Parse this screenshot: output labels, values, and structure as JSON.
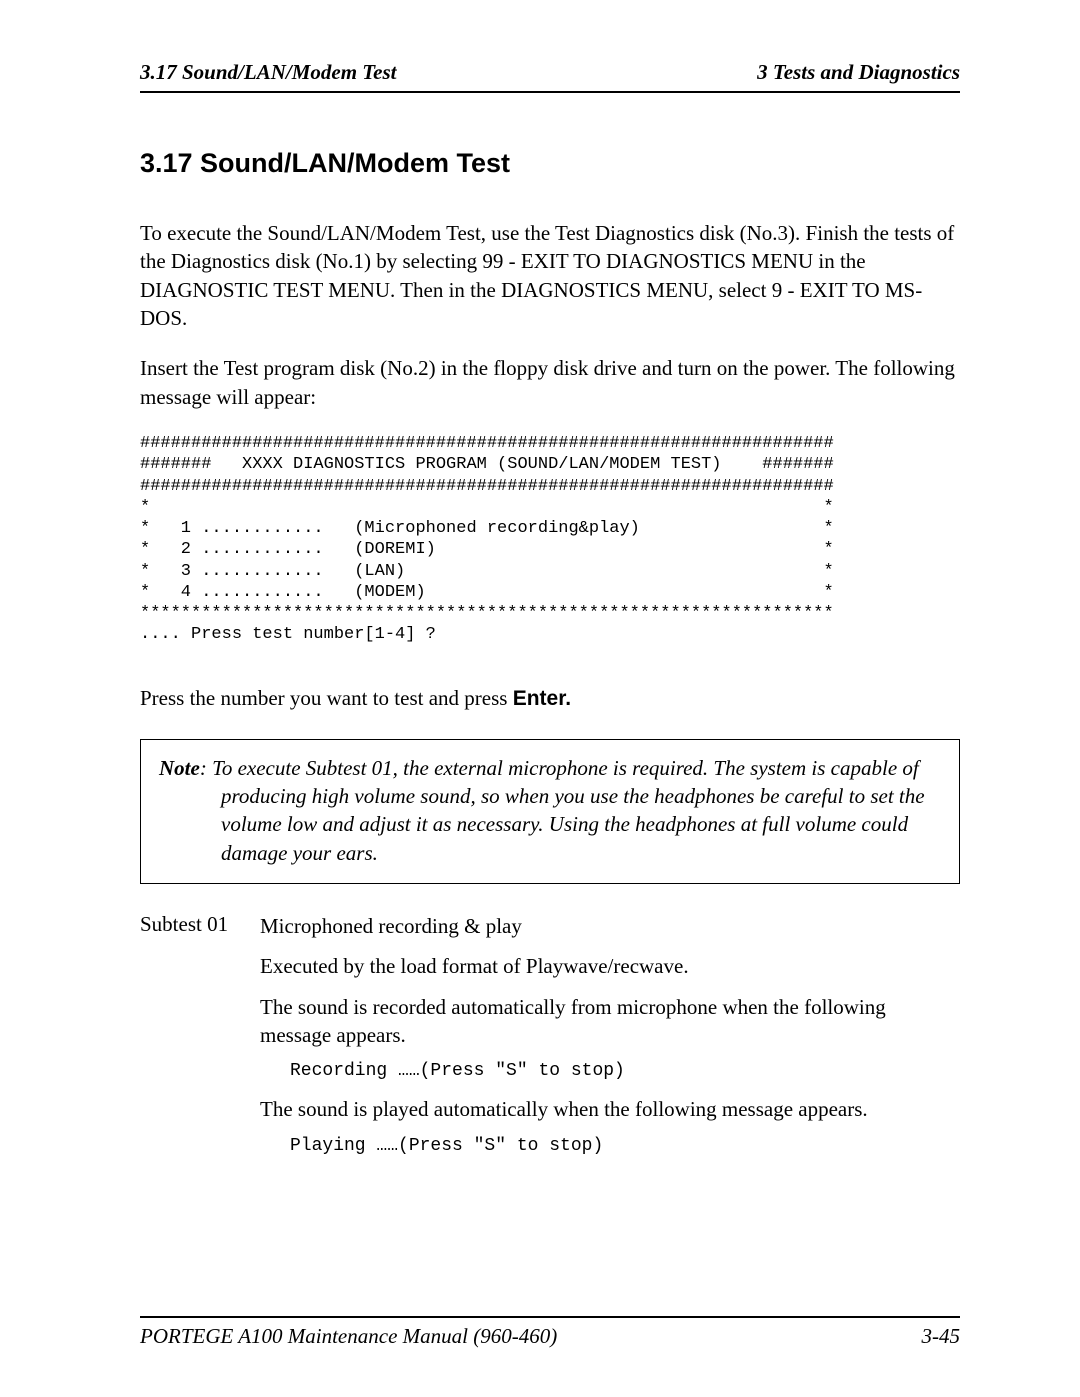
{
  "header": {
    "left": "3.17  Sound/LAN/Modem Test",
    "right": "3 Tests and Diagnostics"
  },
  "heading": "3.17  Sound/LAN/Modem Test",
  "para1": "To execute the Sound/LAN/Modem Test, use the Test Diagnostics disk (No.3). Finish the tests of the Diagnostics disk (No.1) by selecting 99 - EXIT TO DIAGNOSTICS MENU in the DIAGNOSTIC TEST MENU. Then in the DIAGNOSTICS MENU, select 9 - EXIT TO MS-DOS.",
  "para2": "Insert the Test program disk (No.2) in the floppy disk drive and turn on the power. The following message will appear:",
  "code": "####################################################################\n#######   XXXX DIAGNOSTICS PROGRAM (SOUND/LAN/MODEM TEST)    #######\n####################################################################\n*                                                                  *\n*   1 ............   (Microphoned recording&play)                  *\n*   2 ............   (DOREMI)                                      *\n*   3 ............   (LAN)                                         *\n*   4 ............   (MODEM)                                       *\n********************************************************************\n.... Press test number[1-4] ?",
  "press_line_pre": "Press the number you want to test and press ",
  "press_line_enter": "Enter.",
  "note_label": "Note",
  "note_text": ":  To execute Subtest 01, the external microphone is required. The system is capable of producing high volume sound, so when you use the headphones be careful to set the volume low and adjust it as necessary.  Using the headphones at full volume could damage your ears.",
  "subtest": {
    "label": "Subtest 01",
    "title": "Microphoned recording & play",
    "l1": "Executed by the load format of Playwave/recwave.",
    "l2": "The sound is recorded automatically from microphone when the following message appears.",
    "code1": "Recording ……(Press \"S\" to stop)",
    "l3": "The sound is played automatically when the following message appears.",
    "code2": "Playing ……(Press \"S\" to stop)"
  },
  "footer": {
    "left": "PORTEGE A100 Maintenance Manual (960-460)",
    "right": "3-45"
  }
}
